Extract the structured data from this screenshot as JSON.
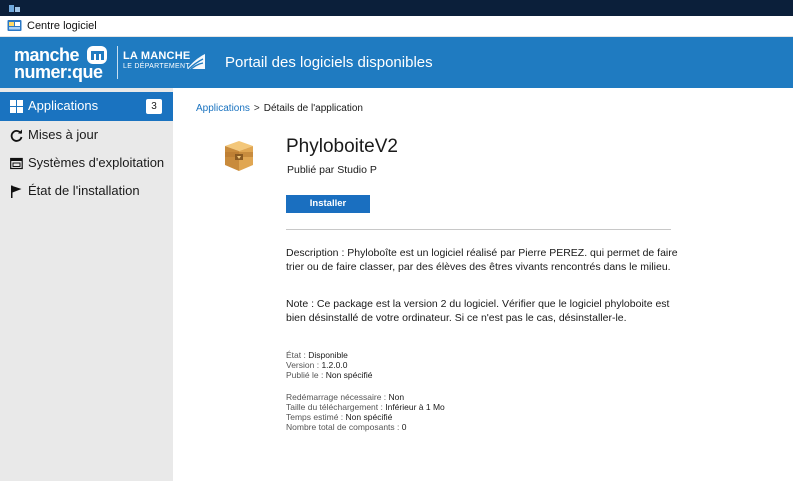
{
  "window": {
    "title": "Centre logiciel"
  },
  "banner": {
    "brand_line1": "manche",
    "brand_line2": "numer:que",
    "dept_name": "LA MANCHE",
    "dept_sub": "LE DÉPARTEMENT",
    "title": "Portail des logiciels disponibles"
  },
  "sidebar": {
    "items": [
      {
        "label": "Applications",
        "icon": "grid-icon",
        "count": "3",
        "active": true
      },
      {
        "label": "Mises à jour",
        "icon": "refresh-icon"
      },
      {
        "label": "Systèmes d'exploitation",
        "icon": "window-icon"
      },
      {
        "label": "État de l'installation",
        "icon": "flag-icon"
      }
    ]
  },
  "breadcrumb": {
    "root": "Applications",
    "separator": ">",
    "current": "Détails de l'application"
  },
  "app": {
    "icon": "package-box-icon",
    "title": "PhyloboiteV2",
    "publisher": "Publié par Studio P",
    "install_label": "Installer",
    "description": "Description : Phyloboîte est un logiciel réalisé par Pierre PEREZ. qui permet de faire trier ou de faire classer, par des élèves des êtres vivants rencontrés dans le milieu.",
    "note": "Note : Ce package est la version 2 du logiciel. Vérifier que le logiciel phyloboite est bien désinstallé de votre ordinateur. Si ce n'est pas le cas, désinstaller-le.",
    "status_label": "État : ",
    "status_value": "Disponible",
    "version_label": "Version : ",
    "version_value": "1.2.0.0",
    "published_label": "Publié le : ",
    "published_value": "Non spécifié",
    "restart_label": "Redémarrage nécessaire : ",
    "restart_value": "Non",
    "download_label": "Taille du téléchargement : ",
    "download_value": "Inférieur à 1 Mo",
    "time_label": "Temps estimé : ",
    "time_value": "Non spécifié",
    "components_label": "Nombre total de composants : ",
    "components_value": "0"
  },
  "colors": {
    "banner": "#1f7bc1",
    "accent": "#1a73c0",
    "sidebar_bg": "#e9e9e9",
    "top_strip": "#0b1f3a"
  }
}
